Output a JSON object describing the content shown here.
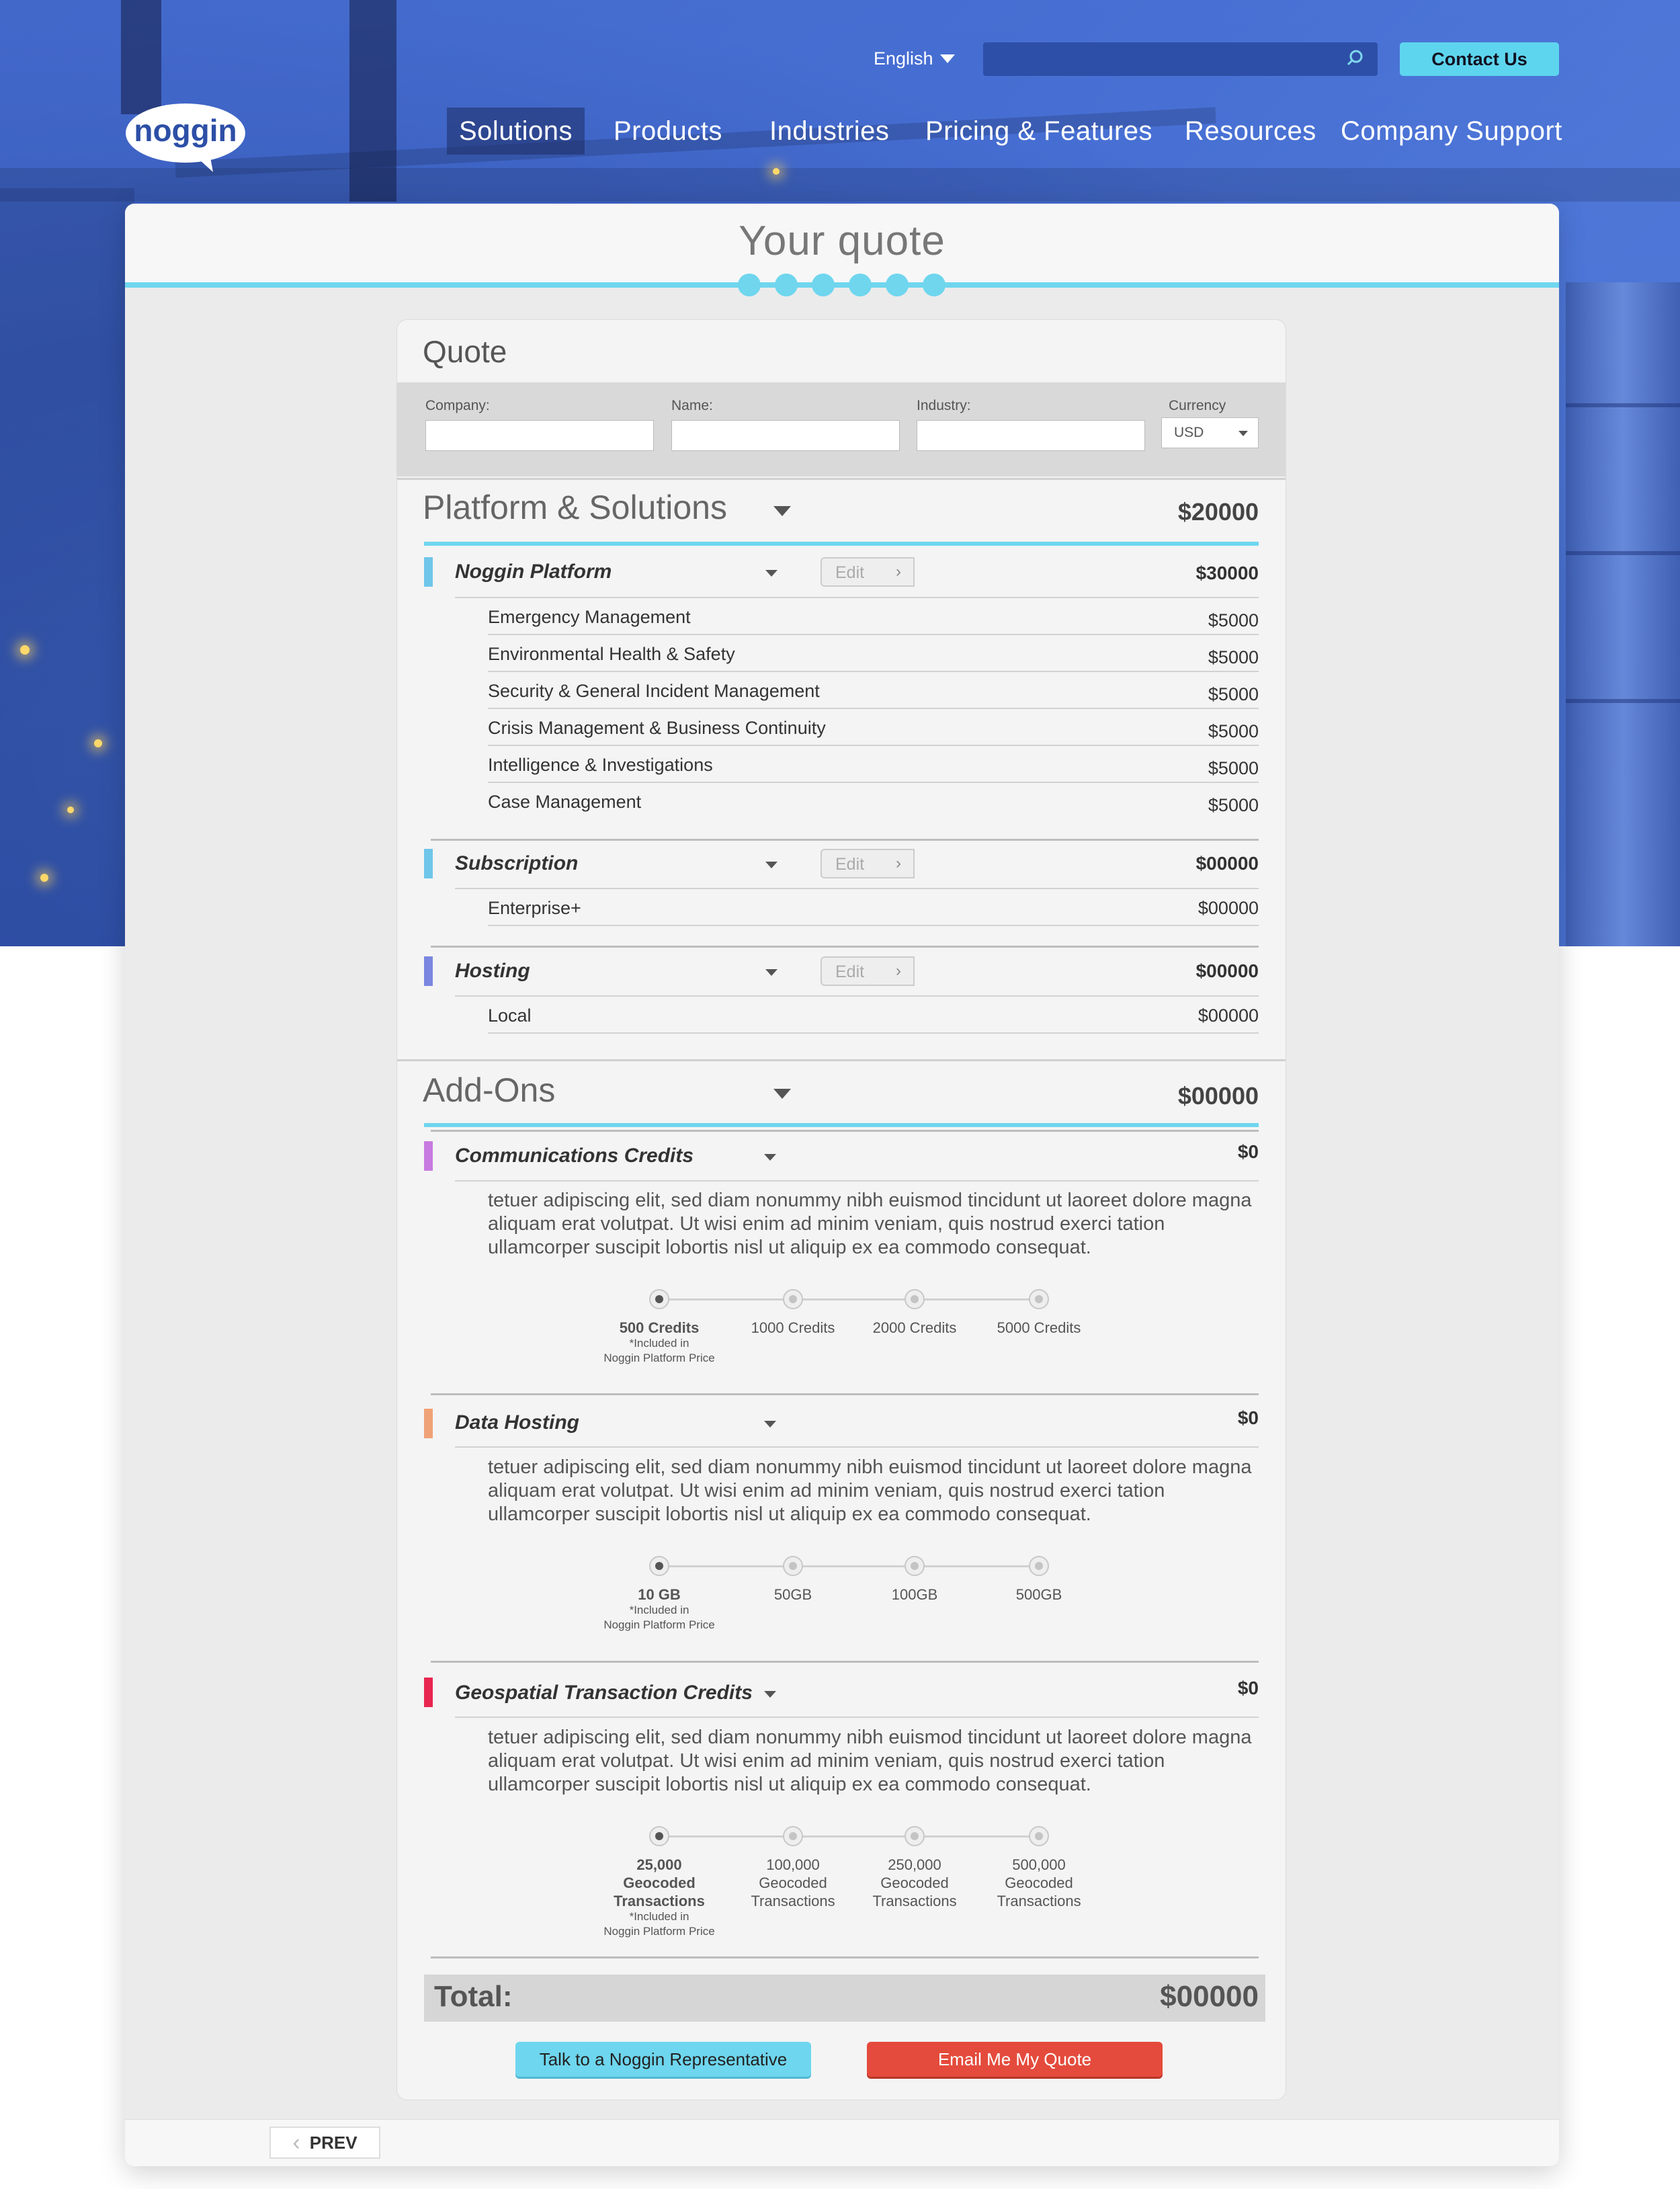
{
  "header": {
    "language": "English",
    "search_placeholder": "",
    "contact_label": "Contact Us",
    "logo_text": "noggin",
    "nav": [
      "Solutions",
      "Products",
      "Industries",
      "Pricing & Features",
      "Resources",
      "Company Support"
    ]
  },
  "page": {
    "title": "Your quote",
    "step_count": 6
  },
  "quote": {
    "title": "Quote",
    "fields": {
      "company_label": "Company:",
      "name_label": "Name:",
      "industry_label": "Industry:",
      "currency_label": "Currency",
      "currency_value": "USD",
      "company_value": "",
      "name_value": "",
      "industry_value": ""
    },
    "platform": {
      "title": "Platform & Solutions",
      "price": "$20000",
      "groups": [
        {
          "title": "Noggin Platform",
          "edit": "Edit",
          "price": "$30000",
          "items": [
            {
              "label": "Emergency Management",
              "price": "$5000"
            },
            {
              "label": "Environmental Health & Safety",
              "price": "$5000"
            },
            {
              "label": "Security & General Incident Management",
              "price": "$5000"
            },
            {
              "label": "Crisis Management & Business Continuity",
              "price": "$5000"
            },
            {
              "label": "Intelligence & Investigations",
              "price": "$5000"
            },
            {
              "label": "Case Management",
              "price": "$5000"
            }
          ]
        },
        {
          "title": "Subscription",
          "edit": "Edit",
          "price": "$00000",
          "items": [
            {
              "label": "Enterprise+",
              "price": "$00000"
            }
          ]
        },
        {
          "title": "Hosting",
          "edit": "Edit",
          "price": "$00000",
          "items": [
            {
              "label": "Local",
              "price": "$00000"
            }
          ]
        }
      ]
    },
    "addons": {
      "title": "Add-Ons",
      "price": "$00000",
      "groups": [
        {
          "title": "Communications Credits",
          "price": "$0",
          "description": "tetuer adipiscing elit, sed diam nonummy nibh euismod tincidunt ut laoreet dolore magna aliquam erat volutpat. Ut wisi enim ad minim veniam, quis nostrud exerci tation ullamcorper suscipit lobortis nisl ut aliquip ex ea commodo consequat.",
          "options": [
            "500 Credits",
            "1000 Credits",
            "2000 Credits",
            "5000 Credits"
          ],
          "selected": 0,
          "note": "*Included in\nNoggin Platform Price"
        },
        {
          "title": "Data Hosting",
          "price": "$0",
          "description": "tetuer adipiscing elit, sed diam nonummy nibh euismod tincidunt ut laoreet dolore magna aliquam erat volutpat. Ut wisi enim ad minim veniam, quis nostrud exerci tation ullamcorper suscipit lobortis nisl ut aliquip ex ea commodo consequat.",
          "options": [
            "10 GB",
            "50GB",
            "100GB",
            "500GB"
          ],
          "selected": 0,
          "note": "*Included in\nNoggin Platform Price"
        },
        {
          "title": "Geospatial Transaction Credits",
          "price": "$0",
          "description": "tetuer adipiscing elit, sed diam nonummy nibh euismod tincidunt ut laoreet dolore magna aliquam erat volutpat. Ut wisi enim ad minim veniam, quis nostrud exerci tation ullamcorper suscipit lobortis nisl ut aliquip ex ea commodo consequat.",
          "options": [
            "25,000\nGeocoded\nTransactions",
            "100,000\nGeocoded\nTransactions",
            "250,000\nGeocoded\nTransactions",
            "500,000\nGeocoded\nTransactions"
          ],
          "selected": 0,
          "note": "*Included in\nNoggin Platform Price"
        }
      ]
    },
    "total_label": "Total:",
    "total_value": "$00000",
    "talk_button": "Talk to a Noggin Representative",
    "email_button": "Email Me My Quote"
  },
  "footer": {
    "prev_label": "PREV"
  },
  "colors": {
    "accent": "#6fd6ee",
    "noggin_platform_bar": "#6fc6ea",
    "subscription_bar": "#6fc6ea",
    "hosting_bar": "#7b86e0",
    "comms_bar": "#c77be0",
    "data_hosting_bar": "#f0a277",
    "geospatial_bar": "#e8264f",
    "email_button": "#e44b3c"
  }
}
